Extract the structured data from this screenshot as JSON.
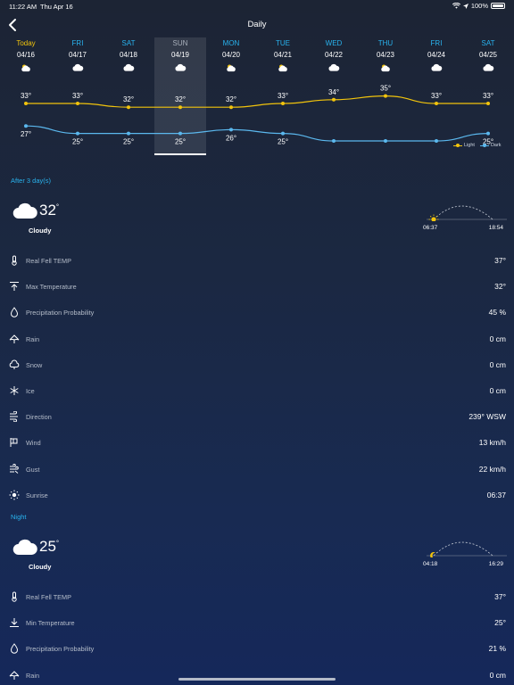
{
  "status_bar": {
    "time": "11:22 AM",
    "date": "Thu Apr 16",
    "battery": "100%"
  },
  "header": {
    "title": "Daily"
  },
  "days": [
    {
      "weekday": "Today",
      "date": "04/16",
      "icon": "sun-cloud-icon",
      "high": "33",
      "low": "27"
    },
    {
      "weekday": "FRI",
      "date": "04/17",
      "icon": "cloud-icon",
      "high": "33",
      "low": "25"
    },
    {
      "weekday": "SAT",
      "date": "04/18",
      "icon": "cloud-icon",
      "high": "32",
      "low": "25"
    },
    {
      "weekday": "SUN",
      "date": "04/19",
      "icon": "cloud-icon",
      "high": "32",
      "low": "25"
    },
    {
      "weekday": "MON",
      "date": "04/20",
      "icon": "sun-cloud-icon",
      "high": "32",
      "low": "26"
    },
    {
      "weekday": "TUE",
      "date": "04/21",
      "icon": "sun-cloud-icon",
      "high": "33",
      "low": "25"
    },
    {
      "weekday": "WED",
      "date": "04/22",
      "icon": "cloud-icon",
      "high": "34",
      "low": "23"
    },
    {
      "weekday": "THU",
      "date": "04/23",
      "icon": "sun-cloud-icon",
      "high": "35",
      "low": "23"
    },
    {
      "weekday": "FRI",
      "date": "04/24",
      "icon": "cloud-icon",
      "high": "33",
      "low": "23"
    },
    {
      "weekday": "SAT",
      "date": "04/25",
      "icon": "cloud-icon",
      "high": "33",
      "low": "25"
    }
  ],
  "selected_day": 3,
  "legend": {
    "light": "Light",
    "dark": "Dark",
    "light_color": "#f2c40c",
    "dark_color": "#5bb8ee"
  },
  "day_section": {
    "label": "After 3  day(s)",
    "temp": "32",
    "condition": "Cloudy",
    "sunrise": "06:37",
    "sunset": "18:54",
    "rows": [
      {
        "icon": "thermometer-icon",
        "label": "Real Fell TEMP",
        "value": "37°"
      },
      {
        "icon": "max-temp-icon",
        "label": "Max Temperature",
        "value": "32°"
      },
      {
        "icon": "drop-icon",
        "label": "Precipitation Probability",
        "value": "45 %"
      },
      {
        "icon": "rain-icon",
        "label": "Rain",
        "value": "0 cm"
      },
      {
        "icon": "snow-icon",
        "label": "Snow",
        "value": "0 cm"
      },
      {
        "icon": "ice-icon",
        "label": "Ice",
        "value": "0 cm"
      },
      {
        "icon": "direction-icon",
        "label": "Direction",
        "value": "239° WSW"
      },
      {
        "icon": "wind-icon",
        "label": "Wind",
        "value": "13 km/h"
      },
      {
        "icon": "gust-icon",
        "label": "Gust",
        "value": "22 km/h"
      },
      {
        "icon": "sunrise-icon",
        "label": "Sunrise",
        "value": "06:37"
      }
    ]
  },
  "night_section": {
    "label": "Night",
    "temp": "25",
    "condition": "Cloudy",
    "moonrise": "04:18",
    "moonset": "16:29",
    "rows": [
      {
        "icon": "thermometer-icon",
        "label": "Real Fell TEMP",
        "value": "37°"
      },
      {
        "icon": "min-temp-icon",
        "label": "Min Temperature",
        "value": "25°"
      },
      {
        "icon": "drop-icon",
        "label": "Precipitation Probability",
        "value": "21 %"
      },
      {
        "icon": "rain-icon",
        "label": "Rain",
        "value": "0 cm"
      }
    ]
  },
  "chart_data": {
    "type": "line",
    "categories": [
      "04/16",
      "04/17",
      "04/18",
      "04/19",
      "04/20",
      "04/21",
      "04/22",
      "04/23",
      "04/24",
      "04/25"
    ],
    "series": [
      {
        "name": "Light",
        "values": [
          33,
          33,
          32,
          32,
          32,
          33,
          34,
          35,
          33,
          33
        ]
      },
      {
        "name": "Dark",
        "values": [
          27,
          25,
          25,
          25,
          26,
          25,
          23,
          23,
          23,
          25
        ]
      }
    ],
    "legend": "bottom-right"
  }
}
